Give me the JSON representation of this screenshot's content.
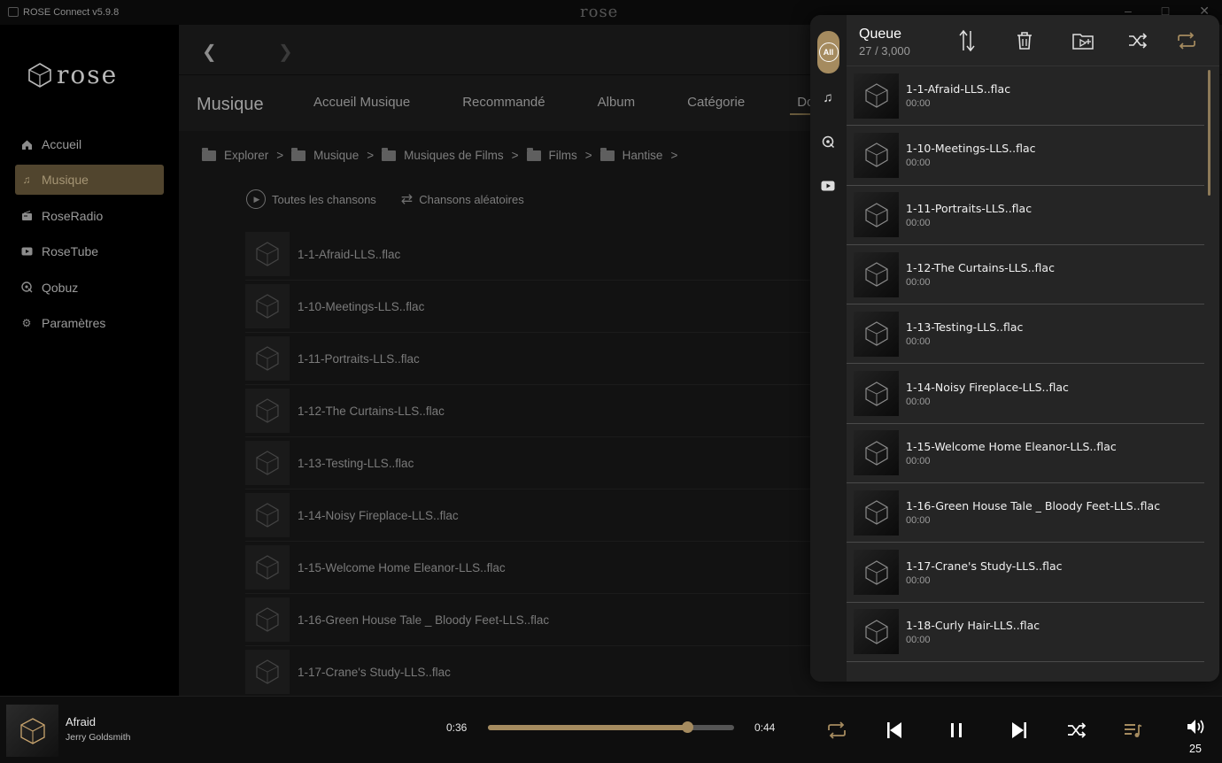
{
  "window": {
    "title": "ROSE Connect v5.9.8",
    "center_logo": "rose"
  },
  "sidebar": {
    "logo_text": "rose",
    "items": [
      {
        "label": "Accueil",
        "icon": "home-icon",
        "active": false
      },
      {
        "label": "Musique",
        "icon": "music-note-icon",
        "active": true
      },
      {
        "label": "RoseRadio",
        "icon": "radio-icon",
        "active": false
      },
      {
        "label": "RoseTube",
        "icon": "youtube-icon",
        "active": false
      },
      {
        "label": "Qobuz",
        "icon": "qobuz-icon",
        "active": false
      },
      {
        "label": "Paramètres",
        "icon": "gear-icon",
        "active": false
      }
    ]
  },
  "main": {
    "section_title": "Musique",
    "tabs": [
      {
        "label": "Accueil Musique"
      },
      {
        "label": "Recommandé"
      },
      {
        "label": "Album"
      },
      {
        "label": "Catégorie"
      },
      {
        "label": "Do"
      }
    ],
    "breadcrumb": [
      "Explorer",
      "Musique",
      "Musiques de Films",
      "Films",
      "Hantise"
    ],
    "actions": {
      "play_all": "Toutes les chansons",
      "shuffle": "Chansons aléatoires"
    },
    "tracks": [
      "1-1-Afraid-LLS..flac",
      "1-10-Meetings-LLS..flac",
      "1-11-Portraits-LLS..flac",
      "1-12-The Curtains-LLS..flac",
      "1-13-Testing-LLS..flac",
      "1-14-Noisy Fireplace-LLS..flac",
      "1-15-Welcome Home Eleanor-LLS..flac",
      "1-16-Green House Tale _ Bloody Feet-LLS..flac",
      "1-17-Crane's Study-LLS..flac"
    ]
  },
  "queue": {
    "title": "Queue",
    "count": "27 / 3,000",
    "rail_all_label": "All",
    "items": [
      {
        "name": "1-1-Afraid-LLS..flac",
        "duration": "00:00"
      },
      {
        "name": "1-10-Meetings-LLS..flac",
        "duration": "00:00"
      },
      {
        "name": "1-11-Portraits-LLS..flac",
        "duration": "00:00"
      },
      {
        "name": "1-12-The Curtains-LLS..flac",
        "duration": "00:00"
      },
      {
        "name": "1-13-Testing-LLS..flac",
        "duration": "00:00"
      },
      {
        "name": "1-14-Noisy Fireplace-LLS..flac",
        "duration": "00:00"
      },
      {
        "name": "1-15-Welcome Home Eleanor-LLS..flac",
        "duration": "00:00"
      },
      {
        "name": "1-16-Green House Tale _ Bloody Feet-LLS..flac",
        "duration": "00:00"
      },
      {
        "name": "1-17-Crane's Study-LLS..flac",
        "duration": "00:00"
      },
      {
        "name": "1-18-Curly Hair-LLS..flac",
        "duration": "00:00"
      }
    ]
  },
  "player": {
    "title": "Afraid",
    "artist": "Jerry Goldsmith",
    "time_current": "0:36",
    "time_total": "0:44",
    "progress": 0.81,
    "volume": "25"
  },
  "colors": {
    "accent": "#a58b5f",
    "sidebar_active_bg": "#51452e",
    "queue_bg": "#252525"
  }
}
